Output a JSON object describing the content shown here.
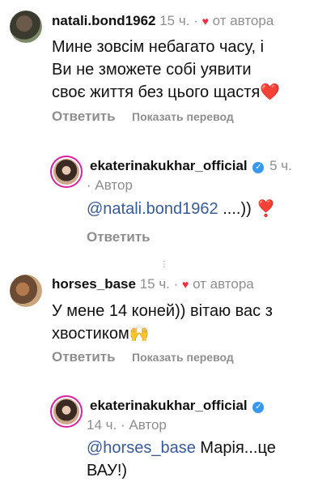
{
  "comments": [
    {
      "username": "natali.bond1962",
      "time": "15 ч.",
      "separator": "·",
      "liked_label": "от автора",
      "text_line1": "Мине зовсім небагато часу, і",
      "text_line2": "Ви не зможете собі уявити",
      "text_line3": "своє життя без цього щастя",
      "text_emoji": "❤️",
      "reply_label": "Ответить",
      "translate_label": "Показать перевод"
    },
    {
      "username": "ekaterinakukhar_official",
      "time": "5 ч.",
      "separator": "·",
      "author_label": "Автор",
      "mention": "@natali.bond1962",
      "text": " ....))",
      "text_emoji": "❣️",
      "reply_label": "Ответить"
    },
    {
      "username": "horses_base",
      "time": "15 ч.",
      "separator": "·",
      "liked_label": "от автора",
      "text_line1": "У мене 14 коней)) вітаю вас з",
      "text_line2": "хвостиком",
      "text_emoji": "🙌",
      "reply_label": "Ответить",
      "translate_label": "Показать перевод"
    },
    {
      "username": "ekaterinakukhar_official",
      "time": "14 ч.",
      "separator": "·",
      "author_label": "Автор",
      "mention": "@horses_base",
      "text_line1": " Марія...це",
      "text_line2": "ВАУ!)"
    }
  ],
  "icons": {
    "heart": "♥",
    "verified": "✓",
    "dots": "⋮"
  },
  "colors": {
    "mention": "#3a5a96",
    "heart": "#ed2f3b",
    "verified": "#3897f0",
    "muted": "#8e8e8e"
  }
}
